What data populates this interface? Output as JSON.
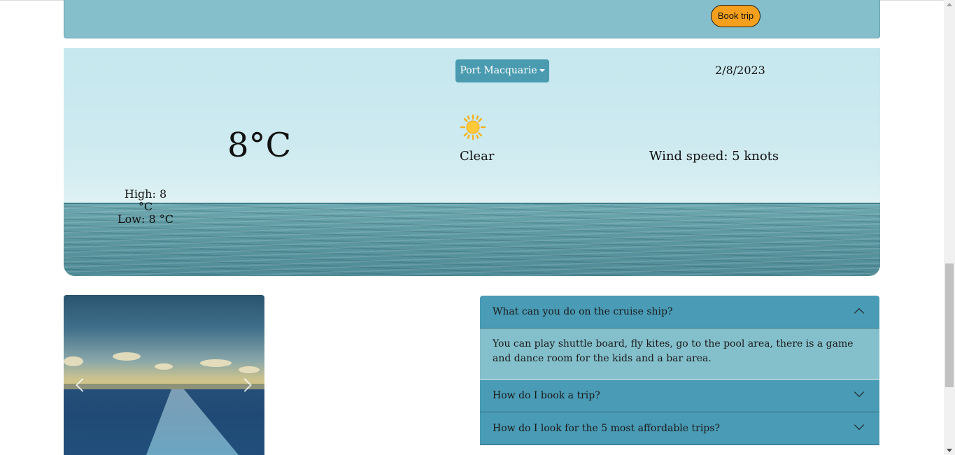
{
  "banner": {
    "book_button_label": "Book trip"
  },
  "weather": {
    "location": "Port Macquarie",
    "date": "2/8/2023",
    "temperature": "8°C",
    "condition": "Clear",
    "condition_icon": "sun-icon",
    "wind": "Wind speed: 5 knots",
    "high": "High: 8 °C",
    "low": "Low: 8 °C"
  },
  "carousel": {
    "prev_icon": "chevron-left-icon",
    "next_icon": "chevron-right-icon"
  },
  "faq": {
    "items": [
      {
        "question": "What can you do on the cruise ship?",
        "answer": "You can play shuttle board, fly kites, go to the pool area, there is a game and dance room for the kids and a bar area.",
        "expanded": true
      },
      {
        "question": "How do I book a trip?",
        "expanded": false
      },
      {
        "question": "How do I look for the 5 most affordable trips?",
        "expanded": false
      }
    ]
  },
  "colors": {
    "banner_bg": "#84bfcb",
    "book_button_bg": "#f5a01d",
    "location_button_bg": "#4a9bb0",
    "faq_header_bg": "#4a9bb5",
    "faq_body_bg": "#84c0cc"
  }
}
